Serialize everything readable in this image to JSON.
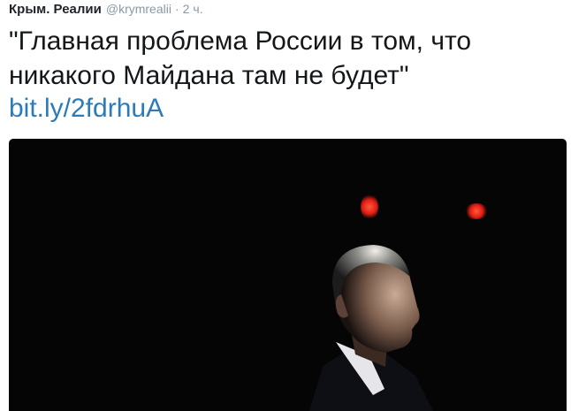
{
  "tweet": {
    "author_name": "Крым. Реалии",
    "author_handle": "@krymrealii",
    "separator": "·",
    "timestamp": "2 ч.",
    "text_lines": [
      "\"Главная проблема России в том, что",
      "никакого Майдана там не будет\""
    ],
    "link": "bit.ly/2fdrhuA"
  },
  "colors": {
    "link": "#2b7bb9",
    "meta": "#8899a6",
    "text": "#14171a",
    "media_background": "#050505",
    "light": "#e01d12"
  }
}
